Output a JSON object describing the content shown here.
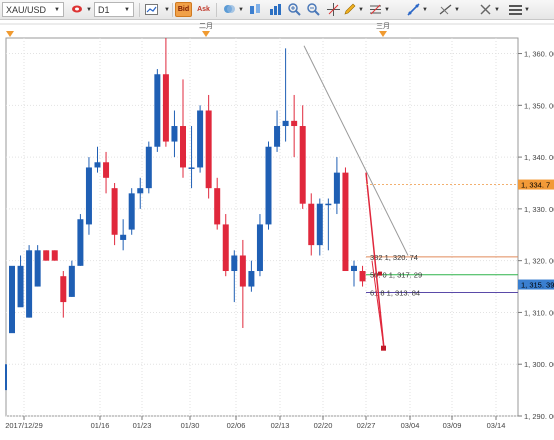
{
  "toolbar": {
    "symbol": "XAU/USD",
    "timeframe": "D1",
    "bid_label": "Bid",
    "ask_label": "Ask",
    "icons": [
      "chart-type-icon",
      "line-style-icon",
      "bar-chart-icon",
      "candlestick-icon",
      "line-chart-icon",
      "zoom-in-icon",
      "zoom-out-icon",
      "pencil-icon",
      "trend-line-icon",
      "fibonacci-icon",
      "crosshair-icon",
      "menu-icon"
    ]
  },
  "colors": {
    "up": "#1f5fb4",
    "down": "#e0283c",
    "fib_1": "#e08a5a",
    "fib_2": "#2fb34a",
    "fib_3": "#5a4aa8",
    "current_price_bg": "#f29a38",
    "blue_price_bg": "#3a7fd0"
  },
  "months": {
    "feb": "二月",
    "mar": "三月"
  },
  "fib_labels": [
    {
      "pct": "382",
      "price": "1, 320. 74"
    },
    {
      "pct": "50. 0",
      "price": "1, 317. 29"
    },
    {
      "pct": "61 8",
      "price": "1, 313. 84"
    }
  ],
  "price_tags": {
    "orange": "1, 334. 7",
    "blue": "1, 315. 39"
  },
  "chart_data": {
    "type": "candlestick",
    "x_ticks": [
      "2017/12/29",
      "01/16",
      "01/23",
      "01/30",
      "02/06",
      "02/13",
      "02/20",
      "02/27",
      "03/04",
      "03/09",
      "03/14"
    ],
    "y_ticks": [
      "1, 360. 00",
      "1, 350. 00",
      "1, 340. 00",
      "1, 330. 00",
      "1, 320. 00",
      "1, 310. 00",
      "1, 300. 00",
      "1, 290. 00"
    ],
    "ylim": [
      1290,
      1363
    ],
    "candles": [
      [
        1306,
        1319,
        1306,
        1306
      ],
      [
        1311,
        1319,
        1321,
        1317
      ],
      [
        1309,
        1322,
        1323,
        1309
      ],
      [
        1315,
        1322,
        1323,
        1315
      ],
      [
        1322,
        1320,
        1322,
        1320
      ],
      [
        1322,
        1320,
        1322,
        1320
      ],
      [
        1317,
        1312,
        1318,
        1309
      ],
      [
        1313,
        1319,
        1320,
        1313
      ],
      [
        1319,
        1328,
        1329,
        1319
      ],
      [
        1327,
        1338,
        1340,
        1325
      ],
      [
        1338,
        1339,
        1342,
        1337
      ],
      [
        1339,
        1336,
        1341,
        1333
      ],
      [
        1334,
        1325,
        1335,
        1323
      ],
      [
        1324,
        1325,
        1328,
        1322
      ],
      [
        1326,
        1333,
        1334,
        1325
      ],
      [
        1333,
        1334,
        1336,
        1330
      ],
      [
        1334,
        1342,
        1343,
        1333
      ],
      [
        1342,
        1356,
        1357,
        1341
      ],
      [
        1356,
        1343,
        1363,
        1342
      ],
      [
        1343,
        1346,
        1349,
        1340
      ],
      [
        1346,
        1338,
        1355,
        1336
      ],
      [
        1338,
        1338,
        1346,
        1334
      ],
      [
        1338,
        1349,
        1350,
        1337
      ],
      [
        1349,
        1334,
        1352,
        1332
      ],
      [
        1334,
        1327,
        1336,
        1326
      ],
      [
        1327,
        1318,
        1329,
        1317
      ],
      [
        1318,
        1321,
        1322,
        1312
      ],
      [
        1321,
        1315,
        1324,
        1307
      ],
      [
        1315,
        1318,
        1320,
        1314
      ],
      [
        1318,
        1327,
        1329,
        1317
      ],
      [
        1327,
        1342,
        1343,
        1326
      ],
      [
        1342,
        1346,
        1349,
        1341
      ],
      [
        1346,
        1347,
        1361,
        1343
      ],
      [
        1347,
        1346,
        1352,
        1340
      ],
      [
        1346,
        1331,
        1350,
        1330
      ],
      [
        1331,
        1323,
        1333,
        1321
      ],
      [
        1323,
        1331,
        1332,
        1321
      ],
      [
        1331,
        1331,
        1332,
        1322
      ],
      [
        1331,
        1337,
        1340,
        1329
      ],
      [
        1337,
        1318,
        1338,
        1318
      ],
      [
        1318,
        1319,
        1320,
        1315
      ],
      [
        1318,
        1316,
        1319,
        1315
      ]
    ]
  }
}
